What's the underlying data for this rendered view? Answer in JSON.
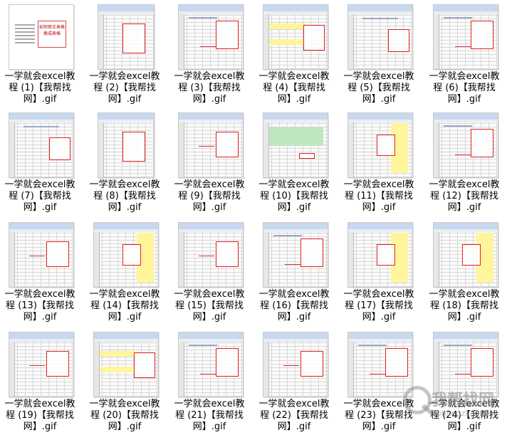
{
  "files": [
    {
      "name": "一学就会excel教程 (1)【我帮找网】.gif",
      "line1": "一学就会excel教",
      "line2": "程 (1)【我帮找",
      "line3": "网】.gif",
      "style": "doc",
      "doc_label": "如何修正表格\n换成表格"
    },
    {
      "name": "一学就会excel教程 (2)【我帮找网】.gif",
      "line1": "一学就会excel教",
      "line2": "程 (2)【我帮找",
      "line3": "网】.gif",
      "style": "portrait"
    },
    {
      "name": "一学就会excel教程 (3)【我帮找网】.gif",
      "line1": "一学就会excel教",
      "line2": "程 (3)【我帮找",
      "line3": "网】.gif",
      "style": "sheet"
    },
    {
      "name": "一学就会excel教程 (4)【我帮找网】.gif",
      "line1": "一学就会excel教",
      "line2": "程 (4)【我帮找",
      "line3": "网】.gif",
      "style": "yellow"
    },
    {
      "name": "一学就会excel教程 (5)【我帮找网】.gif",
      "line1": "一学就会excel教",
      "line2": "程 (5)【我帮找",
      "line3": "网】.gif",
      "style": "title"
    },
    {
      "name": "一学就会excel教程 (6)【我帮找网】.gif",
      "line1": "一学就会excel教",
      "line2": "程 (6)【我帮找",
      "line3": "网】.gif",
      "style": "sheet"
    },
    {
      "name": "一学就会excel教程 (7)【我帮找网】.gif",
      "line1": "一学就会excel教",
      "line2": "程 (7)【我帮找",
      "line3": "网】.gif",
      "style": "title"
    },
    {
      "name": "一学就会excel教程 (8)【我帮找网】.gif",
      "line1": "一学就会excel教",
      "line2": "程 (8)【我帮找",
      "line3": "网】.gif",
      "style": "portrait"
    },
    {
      "name": "一学就会excel教程 (9)【我帮找网】.gif",
      "line1": "一学就会excel教",
      "line2": "程 (9)【我帮找",
      "line3": "网】.gif",
      "style": "plain"
    },
    {
      "name": "一学就会excel教程 (10)【我帮找网】.gif",
      "line1": "一学就会excel教",
      "line2": "程 (10)【我帮找",
      "line3": "网】.gif",
      "style": "green"
    },
    {
      "name": "一学就会excel教程 (11)【我帮找网】.gif",
      "line1": "一学就会excel教",
      "line2": "程 (11)【我帮找",
      "line3": "网】.gif",
      "style": "yellowcol"
    },
    {
      "name": "一学就会excel教程 (12)【我帮找网】.gif",
      "line1": "一学就会excel教",
      "line2": "程 (12)【我帮找",
      "line3": "网】.gif",
      "style": "sheet"
    },
    {
      "name": "一学就会excel教程 (13)【我帮找网】.gif",
      "line1": "一学就会excel教",
      "line2": "程 (13)【我帮找",
      "line3": "网】.gif",
      "style": "plain"
    },
    {
      "name": "一学就会excel教程 (14)【我帮找网】.gif",
      "line1": "一学就会excel教",
      "line2": "程 (14)【我帮找",
      "line3": "网】.gif",
      "style": "yellowcol"
    },
    {
      "name": "一学就会excel教程 (15)【我帮找网】.gif",
      "line1": "一学就会excel教",
      "line2": "程 (15)【我帮找",
      "line3": "网】.gif",
      "style": "plain"
    },
    {
      "name": "一学就会excel教程 (16)【我帮找网】.gif",
      "line1": "一学就会excel教",
      "line2": "程 (16)【我帮找",
      "line3": "网】.gif",
      "style": "sheet"
    },
    {
      "name": "一学就会excel教程 (17)【我帮找网】.gif",
      "line1": "一学就会excel教",
      "line2": "程 (17)【我帮找",
      "line3": "网】.gif",
      "style": "yellowcol"
    },
    {
      "name": "一学就会excel教程 (18)【我帮找网】.gif",
      "line1": "一学就会excel教",
      "line2": "程 (18)【我帮找",
      "line3": "网】.gif",
      "style": "yellowcol"
    },
    {
      "name": "一学就会excel教程 (19)【我帮找网】.gif",
      "line1": "一学就会excel教",
      "line2": "程 (19)【我帮找",
      "line3": "网】.gif",
      "style": "plain"
    },
    {
      "name": "一学就会excel教程 (20)【我帮找网】.gif",
      "line1": "一学就会excel教",
      "line2": "程 (20)【我帮找",
      "line3": "网】.gif",
      "style": "yellow"
    },
    {
      "name": "一学就会excel教程 (21)【我帮找网】.gif",
      "line1": "一学就会excel教",
      "line2": "程 (21)【我帮找",
      "line3": "网】.gif",
      "style": "sheet"
    },
    {
      "name": "一学就会excel教程 (22)【我帮找网】.gif",
      "line1": "一学就会excel教",
      "line2": "程 (22)【我帮找",
      "line3": "网】.gif",
      "style": "plain"
    },
    {
      "name": "一学就会excel教程 (23)【我帮找网】.gif",
      "line1": "一学就会excel教",
      "line2": "程 (23)【我帮找",
      "line3": "网】.gif",
      "style": "sheet"
    },
    {
      "name": "一学就会excel教程 (24)【我帮找网】.gif",
      "line1": "一学就会excel教",
      "line2": "程 (24)【我帮找",
      "line3": "网】.gif",
      "style": "sheet"
    }
  ],
  "watermark": {
    "text": "我帮找网",
    "sub": "wobangzhao.com"
  },
  "colors": {
    "accent_red": "#e02020",
    "highlight_yellow": "#fff59a",
    "highlight_green": "#bfe6bf"
  }
}
